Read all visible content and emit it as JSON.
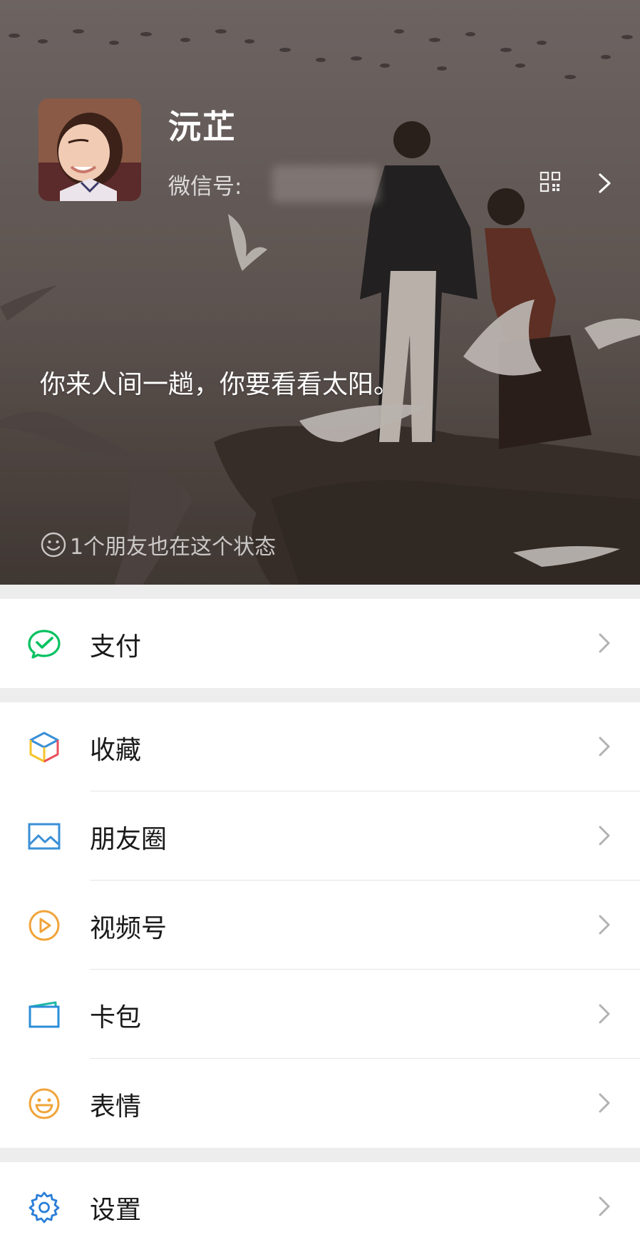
{
  "profile": {
    "name": "沅芷",
    "wechat_id_label": "微信号:",
    "status_text": "你来人间一趟，你要看看太阳。",
    "friends_status_text": "1个朋友也在这个状态"
  },
  "icons": {
    "avatar": "avatar-photo",
    "qr": "qr-code-icon",
    "chevron": "chevron-right-icon",
    "smile": "smile-icon"
  },
  "menu": {
    "pay": {
      "label": "支付",
      "icon": "wechat-pay-icon",
      "color": "#07c160"
    },
    "favorites": {
      "label": "收藏",
      "icon": "cube-icon"
    },
    "moments": {
      "label": "朋友圈",
      "icon": "picture-icon",
      "color": "#3a8fd6"
    },
    "channels": {
      "label": "视频号",
      "icon": "play-circle-icon",
      "color": "#f0a43a"
    },
    "card_wallet": {
      "label": "卡包",
      "icon": "card-icon",
      "color": "#2b8ed8"
    },
    "stickers": {
      "label": "表情",
      "icon": "emoji-icon",
      "color": "#f0a43a"
    },
    "settings": {
      "label": "设置",
      "icon": "gear-icon",
      "color": "#2b7fd8"
    }
  }
}
